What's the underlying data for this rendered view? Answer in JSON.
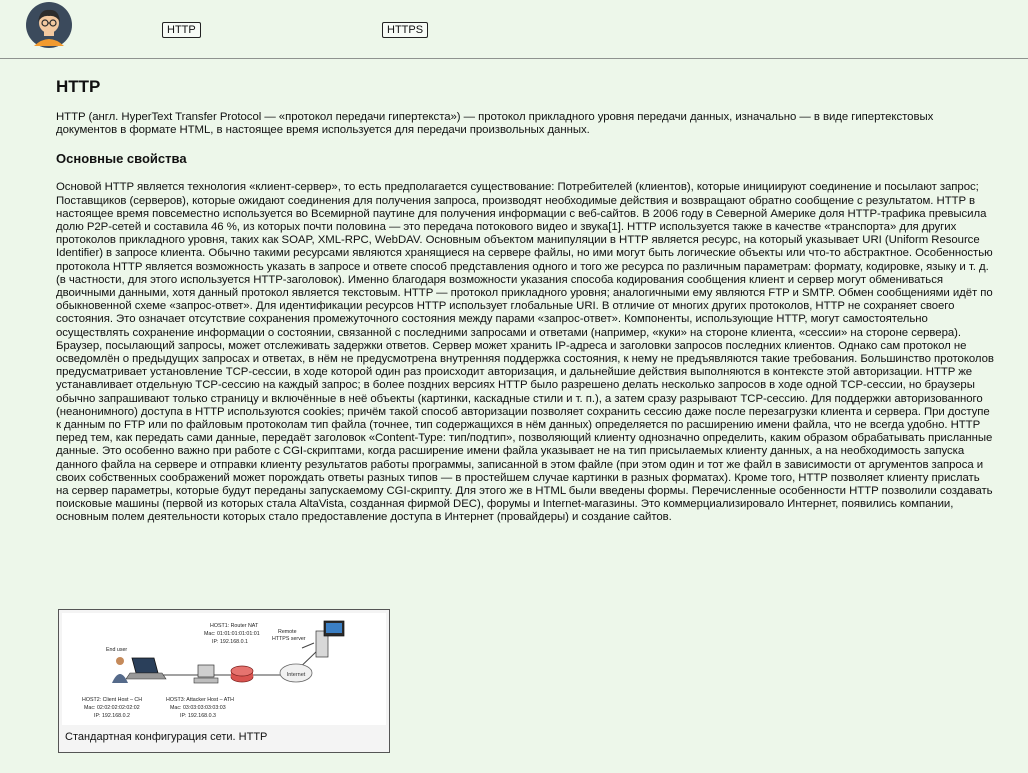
{
  "nav": {
    "http_label": "HTTP",
    "https_label": "HTTPS"
  },
  "article": {
    "title": "HTTP",
    "lead": "HTTP (англ. HyperText Transfer Protocol — «протокол передачи гипертекста») — протокол прикладного уровня передачи данных, изначально — в виде гипертекстовых документов в формате HTML, в настоящее время используется для передачи произвольных данных.",
    "section_title": "Основные свойства",
    "body": "Основой HTTP является технология «клиент-сервер», то есть предполагается существование: Потребителей (клиентов), которые инициируют соединение и посылают запрос; Поставщиков (серверов), которые ожидают соединения для получения запроса, производят необходимые действия и возвращают обратно сообщение с результатом. HTTP в настоящее время повсеместно используется во Всемирной паутине для получения информации с веб-сайтов. В 2006 году в Северной Америке доля HTTP-трафика превысила долю P2P-сетей и составила 46 %, из которых почти половина — это передача потокового видео и звука[1]. HTTP используется также в качестве «транспорта» для других протоколов прикладного уровня, таких как SOAP, XML-RPC, WebDAV. Основным объектом манипуляции в HTTP является ресурс, на который указывает URI (Uniform Resource Identifier) в запросе клиента. Обычно такими ресурсами являются хранящиеся на сервере файлы, но ими могут быть логические объекты или что-то абстрактное. Особенностью протокола HTTP является возможность указать в запросе и ответе способ представления одного и того же ресурса по различным параметрам: формату, кодировке, языку и т. д. (в частности, для этого используется HTTP-заголовок). Именно благодаря возможности указания способа кодирования сообщения клиент и сервер могут обмениваться двоичными данными, хотя данный протокол является текстовым. HTTP — протокол прикладного уровня; аналогичными ему являются FTP и SMTP. Обмен сообщениями идёт по обыкновенной схеме «запрос-ответ». Для идентификации ресурсов HTTP использует глобальные URI. В отличие от многих других протоколов, HTTP не сохраняет своего состояния. Это означает отсутствие сохранения промежуточного состояния между парами «запрос-ответ». Компоненты, использующие HTTP, могут самостоятельно осуществлять сохранение информации о состоянии, связанной с последними запросами и ответами (например, «куки» на стороне клиента, «сессии» на стороне сервера). Браузер, посылающий запросы, может отслеживать задержки ответов. Сервер может хранить IP-адреса и заголовки запросов последних клиентов. Однако сам протокол не осведомлён о предыдущих запросах и ответах, в нём не предусмотрена внутренняя поддержка состояния, к нему не предъявляются такие требования. Большинство протоколов предусматривает установление TCP-сессии, в ходе которой один раз происходит авторизация, и дальнейшие действия выполняются в контексте этой авторизации. HTTP же устанавливает отдельную TCP-сессию на каждый запрос; в более поздних версиях HTTP было разрешено делать несколько запросов в ходе одной TCP-сессии, но браузеры обычно запрашивают только страницу и включённые в неё объекты (картинки, каскадные стили и т. п.), а затем сразу разрывают TCP-сессию. Для поддержки авторизованного (неанонимного) доступа в HTTP используются cookies; причём такой способ авторизации позволяет сохранить сессию даже после перезагрузки клиента и сервера. При доступе к данным по FTP или по файловым протоколам тип файла (точнее, тип содержащихся в нём данных) определяется по расширению имени файла, что не всегда удобно. HTTP перед тем, как передать сами данные, передаёт заголовок «Content-Type: тип/подтип», позволяющий клиенту однозначно определить, каким образом обрабатывать присланные данные. Это особенно важно при работе с CGI-скриптами, когда расширение имени файла указывает не на тип присылаемых клиенту данных, а на необходимость запуска данного файла на сервере и отправки клиенту результатов работы программы, записанной в этом файле (при этом один и тот же файл в зависимости от аргументов запроса и своих собственных соображений может порождать ответы разных типов — в простейшем случае картинки в разных форматах). Кроме того, HTTP позволяет клиенту прислать на сервер параметры, которые будут переданы запускаемому CGI-скрипту. Для этого же в HTML были введены формы. Перечисленные особенности HTTP позволили создавать поисковые машины (первой из которых стала AltaVista, созданная фирмой DEC), форумы и Internet-магазины. Это коммерциализировало Интернет, появились компании, основным полем деятельности которых стало предоставление доступа в Интернет (провайдеры) и создание сайтов."
  },
  "figure": {
    "caption": "Стандартная конфигурация сети. HTTP",
    "labels": {
      "end_user": "End user",
      "host1_title": "HOST1: Router NAT",
      "host1_mac": "Mac: 01:01:01:01:01:01",
      "host1_ip": "IP: 192.168.0.1",
      "remote_1": "Remote",
      "remote_2": "HTTPS server",
      "internet": "Internet",
      "host2_title": "HOST2: Client Host – CH",
      "host2_mac": "Mac: 02:02:02:02:02:02",
      "host2_ip": "IP: 192.168.0.2",
      "host3_title": "HOST3: Attacker Host – ATH",
      "host3_mac": "Mac: 03:03:03:03:03:03",
      "host3_ip": "IP: 192.168.0.3"
    }
  },
  "colors": {
    "background": "#edf7ea",
    "router": "#d9534f"
  }
}
